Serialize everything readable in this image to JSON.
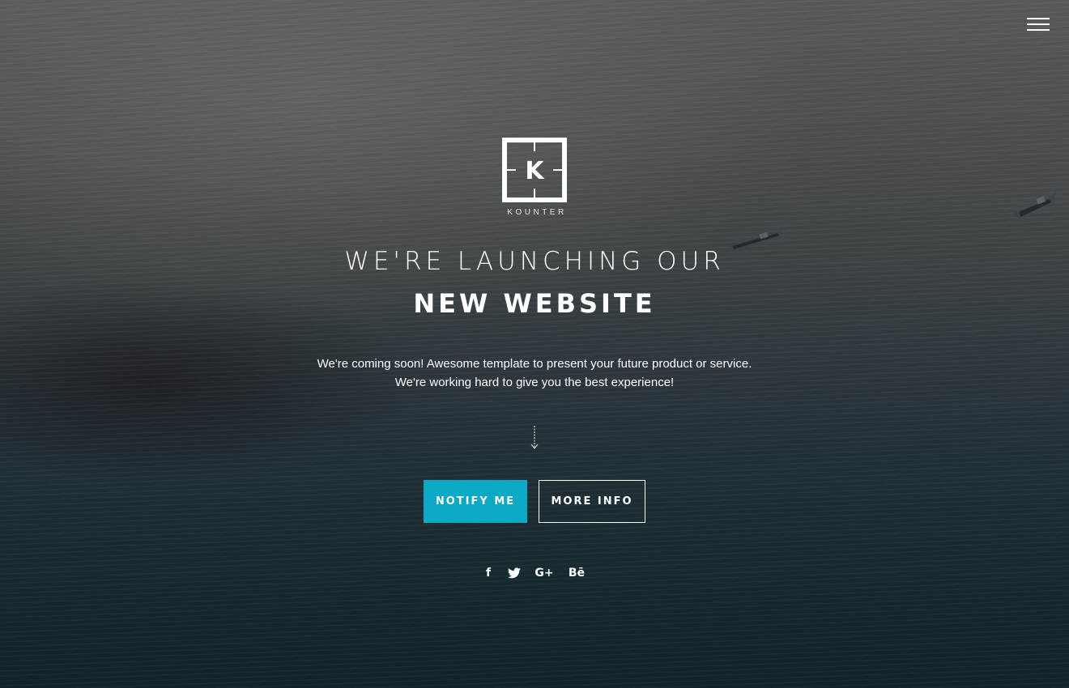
{
  "brand": {
    "logo_letter": "K",
    "name": "KOUNTER"
  },
  "hero": {
    "title_line_1": "WE'RE LAUNCHING OUR",
    "title_line_2": "NEW WEBSITE",
    "description_line_1": "We're coming soon! Awesome template to present your future product or service.",
    "description_line_2": "We're working hard to give you the best experience!"
  },
  "actions": {
    "notify_label": "NOTIFY ME",
    "more_info_label": "MORE INFO"
  },
  "social": {
    "facebook_glyph": "f",
    "google_plus_glyph": "G+",
    "behance_glyph": "Bē"
  },
  "icons": {
    "menu": "hamburger-menu-icon",
    "scroll": "arrow-down-icon",
    "facebook": "facebook-icon",
    "twitter": "twitter-icon",
    "google_plus": "google-plus-icon",
    "behance": "behance-icon"
  },
  "colors": {
    "accent": "#0ba9c6",
    "text": "#ffffff"
  }
}
